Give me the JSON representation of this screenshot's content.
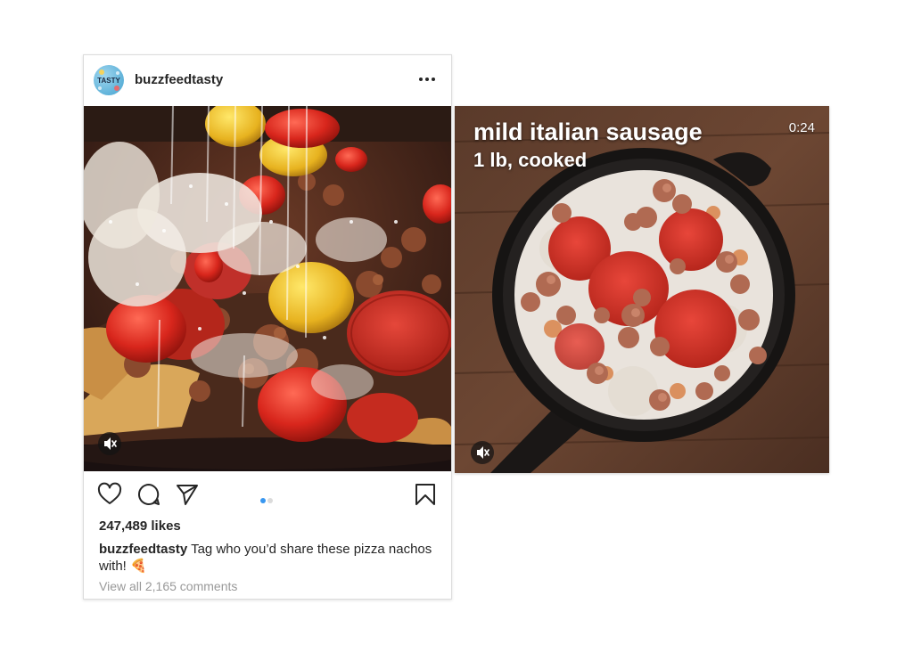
{
  "post": {
    "avatar_text": "TASTY",
    "username": "buzzfeedtasty",
    "more_icon": "more-dots-icon",
    "likes": "247,489 likes",
    "caption_user": "buzzfeedtasty",
    "caption_text": "Tag who you’d share these pizza nachos with! 🍕",
    "comments_link": "View all 2,165 comments",
    "carousel_active": 1,
    "carousel_total": 2,
    "icons": [
      "heart-icon",
      "comment-icon",
      "share-icon",
      "bookmark-icon",
      "mute-icon"
    ]
  },
  "video": {
    "title": "mild italian sausage",
    "subtitle": "1 lb, cooked",
    "time": "0:24"
  },
  "colors": {
    "accent_blue": "#3897f0",
    "text": "#262626",
    "muted": "#999999",
    "border": "#dcdcdc"
  }
}
